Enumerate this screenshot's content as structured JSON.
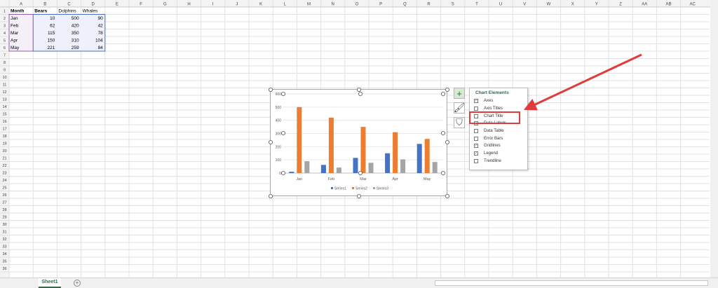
{
  "columns": [
    "A",
    "B",
    "C",
    "D",
    "E",
    "F",
    "G",
    "H",
    "I",
    "J",
    "K",
    "L",
    "M",
    "N",
    "O",
    "P",
    "Q",
    "R",
    "S",
    "T",
    "U",
    "V",
    "W",
    "X",
    "Y",
    "Z",
    "AA",
    "AB",
    "AC"
  ],
  "row_count": 36,
  "table": {
    "headers": [
      "Month",
      "Bears",
      "Dolphins",
      "Whales"
    ],
    "rows": [
      [
        "Jan",
        10,
        500,
        90
      ],
      [
        "Feb",
        62,
        420,
        42
      ],
      [
        "Mar",
        115,
        350,
        78
      ],
      [
        "Apr",
        150,
        310,
        104
      ],
      [
        "May",
        221,
        259,
        84
      ]
    ]
  },
  "chart_data": {
    "type": "bar",
    "categories": [
      "Jan",
      "Feb",
      "Mar",
      "Apr",
      "May"
    ],
    "series": [
      {
        "name": "Series1",
        "values": [
          10,
          62,
          115,
          150,
          221
        ],
        "color": "#4472c4"
      },
      {
        "name": "Series2",
        "values": [
          500,
          420,
          350,
          310,
          259
        ],
        "color": "#ed7d31"
      },
      {
        "name": "Series3",
        "values": [
          90,
          42,
          78,
          104,
          84
        ],
        "color": "#a5a5a5"
      }
    ],
    "ylim": [
      0,
      600
    ],
    "yticks": [
      0,
      100,
      200,
      300,
      400,
      500,
      600
    ],
    "grid": true,
    "legend": "bottom"
  },
  "side_buttons": [
    {
      "icon": "plus-icon",
      "glyph": "+"
    },
    {
      "icon": "brush-icon",
      "glyph": "🖌"
    },
    {
      "icon": "filter-icon",
      "glyph": "⛉"
    }
  ],
  "chart_elements": {
    "title": "Chart Elements",
    "options": [
      {
        "label": "Axes",
        "checked": true
      },
      {
        "label": "Axis Titles",
        "checked": false
      },
      {
        "label": "Chart Title",
        "checked": false
      },
      {
        "label": "Data Labels",
        "checked": false
      },
      {
        "label": "Data Table",
        "checked": false
      },
      {
        "label": "Error Bars",
        "checked": false
      },
      {
        "label": "Gridlines",
        "checked": true
      },
      {
        "label": "Legend",
        "checked": true
      },
      {
        "label": "Trendline",
        "checked": false
      }
    ]
  },
  "annotation": {
    "color": "#e03c3c",
    "highlight": "Chart Title"
  },
  "sheet_tabs": [
    {
      "label": "Sheet1",
      "active": true
    }
  ],
  "add_sheet": "+"
}
